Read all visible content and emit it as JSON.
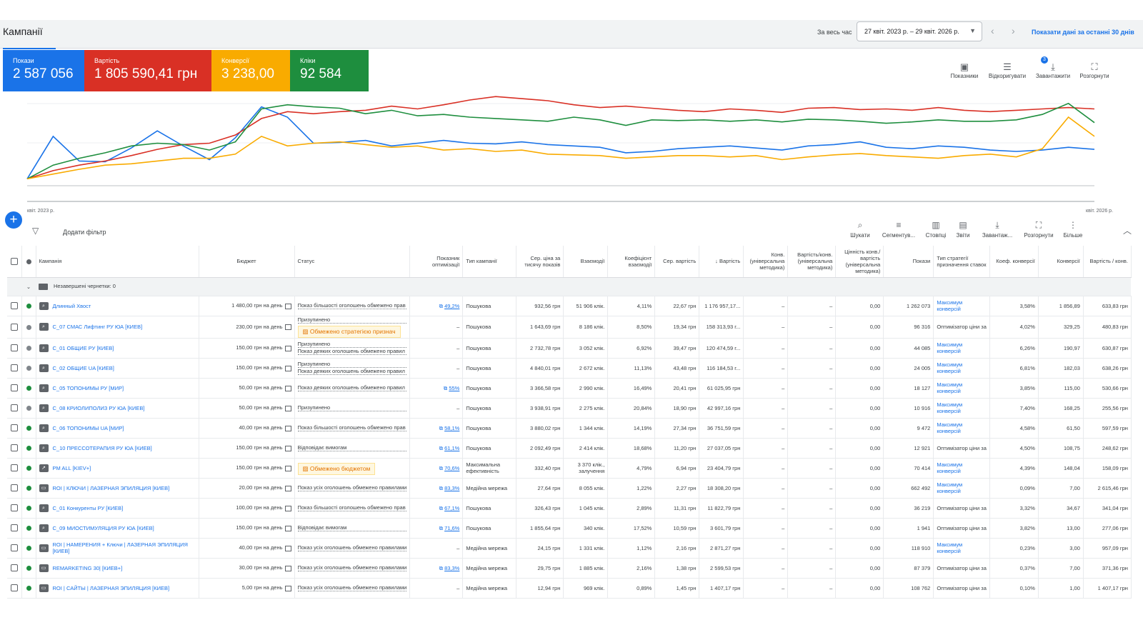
{
  "header": {
    "title": "Кампанії",
    "period_label": "За весь час",
    "date_range": "27 квіт. 2023 р. – 29 квіт. 2026 р.",
    "show_30_label": "Показати дані за останні 30 днів"
  },
  "metrics": [
    {
      "label": "Покази",
      "value": "2 587 056",
      "color": "#1a73e8"
    },
    {
      "label": "Вартість",
      "value": "1 805 590,41 грн",
      "color": "#d93025"
    },
    {
      "label": "Конверсії",
      "value": "3 238,00",
      "color": "#f9ab00"
    },
    {
      "label": "Кліки",
      "value": "92 584",
      "color": "#1e8e3e"
    }
  ],
  "chart_tools": [
    {
      "label": "Показники",
      "icon": "add-chart-icon"
    },
    {
      "label": "Відкоригувати",
      "icon": "tune-icon",
      "badge": "3"
    },
    {
      "label": "Завантажити",
      "icon": "download-icon"
    },
    {
      "label": "Розгорнути",
      "icon": "fullscreen-icon"
    }
  ],
  "chart_data": {
    "type": "line",
    "x_start_label": "квіт. 2023 р.",
    "x_end_label": "квіт. 2026 р.",
    "series": [
      {
        "color": "#1a73e8",
        "values": [
          10,
          72,
          36,
          35,
          55,
          80,
          58,
          38,
          70,
          115,
          100,
          62,
          63,
          66,
          58,
          62,
          66,
          62,
          61,
          64,
          60,
          58,
          56,
          48,
          50,
          54,
          56,
          58,
          55,
          52,
          58,
          60,
          64,
          56,
          54,
          58,
          56,
          52,
          50,
          52,
          56,
          53
        ]
      },
      {
        "color": "#d93025",
        "values": [
          10,
          22,
          30,
          36,
          44,
          53,
          60,
          62,
          74,
          98,
          108,
          105,
          108,
          110,
          116,
          112,
          118,
          125,
          130,
          127,
          124,
          118,
          114,
          116,
          113,
          110,
          108,
          112,
          110,
          107,
          113,
          114,
          111,
          112,
          110,
          114,
          110,
          108,
          110,
          112,
          114,
          112
        ]
      },
      {
        "color": "#1e8e3e",
        "values": [
          10,
          30,
          40,
          48,
          58,
          62,
          60,
          52,
          64,
          112,
          118,
          115,
          113,
          105,
          110,
          102,
          104,
          100,
          98,
          96,
          94,
          100,
          96,
          88,
          96,
          95,
          96,
          94,
          96,
          93,
          97,
          96,
          94,
          91,
          93,
          96,
          94,
          94,
          96,
          104,
          120,
          92
        ]
      },
      {
        "color": "#f9ab00",
        "values": [
          10,
          17,
          24,
          30,
          32,
          36,
          40,
          40,
          46,
          72,
          58,
          62,
          64,
          60,
          56,
          58,
          52,
          54,
          50,
          52,
          46,
          45,
          44,
          40,
          42,
          44,
          44,
          42,
          44,
          38,
          42,
          45,
          47,
          44,
          42,
          40,
          44,
          46,
          42,
          54,
          100,
          72
        ]
      }
    ]
  },
  "filter": {
    "add_label": "Додати фільтр"
  },
  "table_tools": [
    {
      "label": "Шукати",
      "icon": "search-icon"
    },
    {
      "label": "Сегментув...",
      "icon": "segment-icon"
    },
    {
      "label": "Стовпці",
      "icon": "columns-icon"
    },
    {
      "label": "Звіти",
      "icon": "reports-icon"
    },
    {
      "label": "Завантаж...",
      "icon": "download-icon"
    },
    {
      "label": "Розгорнути",
      "icon": "fullscreen-icon"
    },
    {
      "label": "Більше",
      "icon": "more-icon"
    }
  ],
  "columns": [
    "Кампанія",
    "Бюджет",
    "Статус",
    "Показник оптимізації",
    "Тип кампанії",
    "Сер. ціна за тисячу показів",
    "Взаємодії",
    "Коефіцієнт взаємодії",
    "Сер. вартість",
    "↓ Вартість",
    "Конв. (універсальна методика)",
    "Вартість/конв. (універсальна методика)",
    "Цінність конв./вартість (універсальна методика)",
    "Покази",
    "Тип стратегії призначення ставок",
    "Коеф. конверсії",
    "Конверсії",
    "Вартість / конв."
  ],
  "draft_label": "Незавершені чернетки: 0",
  "rows": [
    {
      "status_dot": "#1e8e3e",
      "icon": "search-campaign-icon",
      "name": "Длинный Хвост",
      "budget": "1 480,00 грн на день",
      "status": "Показ більшості оголошень обмежено прав",
      "chip": "",
      "opt": "49,2%",
      "type": "Пошукова",
      "cpm": "932,56 грн",
      "inter": "51 906 клік.",
      "ir": "4,11%",
      "avg": "22,67 грн",
      "cost": "1 176 957,17...",
      "conv_u": "–",
      "cpc_u": "–",
      "val_u": "0,00",
      "impr": "1 262 073",
      "strat": "Максимум конверсій",
      "strat_link": true,
      "cr": "3,58%",
      "conv": "1 856,89",
      "cpa": "633,83 грн"
    },
    {
      "status_dot": "#80868b",
      "icon": "search-campaign-icon",
      "name": "С_07 СМАС Лифтинг РУ ЮА [КИЕВ]",
      "budget": "230,00 грн на день",
      "status": "Призупинено",
      "chip": "Обмежено стратегією признач",
      "opt": "–",
      "type": "Пошукова",
      "cpm": "1 643,69 грн",
      "inter": "8 186 клік.",
      "ir": "8,50%",
      "avg": "19,34 грн",
      "cost": "158 313,93 г...",
      "conv_u": "–",
      "cpc_u": "–",
      "val_u": "0,00",
      "impr": "96 316",
      "strat": "Оптимізатор ціни за",
      "strat_link": false,
      "cr": "4,02%",
      "conv": "329,25",
      "cpa": "480,83 грн"
    },
    {
      "status_dot": "#80868b",
      "icon": "search-campaign-icon",
      "name": "С_01 ОБЩИЕ РУ [КИЕВ]",
      "budget": "150,00 грн на день",
      "status": "Призупинено",
      "status2": "Показ деяких оголошень обмежено правил",
      "chip": "",
      "opt": "–",
      "type": "Пошукова",
      "cpm": "2 732,78 грн",
      "inter": "3 052 клік.",
      "ir": "6,92%",
      "avg": "39,47 грн",
      "cost": "120 474,59 г...",
      "conv_u": "–",
      "cpc_u": "–",
      "val_u": "0,00",
      "impr": "44 085",
      "strat": "Максимум конверсій",
      "strat_link": true,
      "cr": "6,26%",
      "conv": "190,97",
      "cpa": "630,87 грн"
    },
    {
      "status_dot": "#80868b",
      "icon": "search-campaign-icon",
      "name": "С_02 ОБЩИЕ UA [КИЕВ]",
      "budget": "150,00 грн на день",
      "status": "Призупинено",
      "status2": "Показ деяких оголошень обмежено правил",
      "chip": "",
      "opt": "–",
      "type": "Пошукова",
      "cpm": "4 840,01 грн",
      "inter": "2 672 клік.",
      "ir": "11,13%",
      "avg": "43,48 грн",
      "cost": "116 184,53 г...",
      "conv_u": "–",
      "cpc_u": "–",
      "val_u": "0,00",
      "impr": "24 005",
      "strat": "Максимум конверсій",
      "strat_link": true,
      "cr": "6,81%",
      "conv": "182,03",
      "cpa": "638,26 грн"
    },
    {
      "status_dot": "#1e8e3e",
      "icon": "search-campaign-icon",
      "name": "С_05 ТОПОНИМЫ РУ [МИР]",
      "budget": "50,00 грн на день",
      "status": "Показ деяких оголошень обмежено правил",
      "chip": "",
      "opt": "55%",
      "type": "Пошукова",
      "cpm": "3 366,58 грн",
      "inter": "2 990 клік.",
      "ir": "16,49%",
      "avg": "20,41 грн",
      "cost": "61 025,95 грн",
      "conv_u": "–",
      "cpc_u": "–",
      "val_u": "0,00",
      "impr": "18 127",
      "strat": "Максимум конверсій",
      "strat_link": true,
      "cr": "3,85%",
      "conv": "115,00",
      "cpa": "530,66 грн"
    },
    {
      "status_dot": "#80868b",
      "icon": "search-campaign-icon",
      "name": "С_08 КРИОЛИПОЛИЗ РУ ЮА [КИЕВ]",
      "budget": "50,00 грн на день",
      "status": "Призупинено",
      "chip": "",
      "opt": "–",
      "type": "Пошукова",
      "cpm": "3 938,91 грн",
      "inter": "2 275 клік.",
      "ir": "20,84%",
      "avg": "18,90 грн",
      "cost": "42 997,16 грн",
      "conv_u": "–",
      "cpc_u": "–",
      "val_u": "0,00",
      "impr": "10 916",
      "strat": "Максимум конверсій",
      "strat_link": true,
      "cr": "7,40%",
      "conv": "168,25",
      "cpa": "255,56 грн"
    },
    {
      "status_dot": "#1e8e3e",
      "icon": "search-campaign-icon",
      "name": "С_06 ТОПОНИМЫ UA [МИР]",
      "budget": "40,00 грн на день",
      "status": "Показ більшості оголошень обмежено прав",
      "chip": "",
      "opt": "58,1%",
      "type": "Пошукова",
      "cpm": "3 880,02 грн",
      "inter": "1 344 клік.",
      "ir": "14,19%",
      "avg": "27,34 грн",
      "cost": "36 751,59 грн",
      "conv_u": "–",
      "cpc_u": "–",
      "val_u": "0,00",
      "impr": "9 472",
      "strat": "Максимум конверсій",
      "strat_link": true,
      "cr": "4,58%",
      "conv": "61,50",
      "cpa": "597,59 грн"
    },
    {
      "status_dot": "#1e8e3e",
      "icon": "search-campaign-icon",
      "name": "С_10 ПРЕССОТЕРАПИЯ РУ ЮА [КИЕВ]",
      "budget": "150,00 грн на день",
      "status": "Відповідає вимогам",
      "chip": "",
      "opt": "61,1%",
      "type": "Пошукова",
      "cpm": "2 092,49 грн",
      "inter": "2 414 клік.",
      "ir": "18,68%",
      "avg": "11,20 грн",
      "cost": "27 037,05 грн",
      "conv_u": "–",
      "cpc_u": "–",
      "val_u": "0,00",
      "impr": "12 921",
      "strat": "Оптимізатор ціни за",
      "strat_link": false,
      "cr": "4,50%",
      "conv": "108,75",
      "cpa": "248,62 грн"
    },
    {
      "status_dot": "#1e8e3e",
      "icon": "pmax-campaign-icon",
      "name": "PM ALL [KIEV+]",
      "budget": "150,00 грн на день",
      "status": "",
      "chip": "Обмежено бюджетом",
      "opt": "70,6%",
      "type": "Максимальна ефективність",
      "cpm": "332,40 грн",
      "inter": "3 370 клік., залучення",
      "ir": "4,79%",
      "avg": "6,94 грн",
      "cost": "23 404,79 грн",
      "conv_u": "–",
      "cpc_u": "–",
      "val_u": "0,00",
      "impr": "70 414",
      "strat": "Максимум конверсій",
      "strat_link": true,
      "cr": "4,39%",
      "conv": "148,04",
      "cpa": "158,09 грн"
    },
    {
      "status_dot": "#1e8e3e",
      "icon": "display-campaign-icon",
      "name": "ROI | КЛЮЧИ | ЛАЗЕРНАЯ ЭПИЛЯЦИЯ [КИЕВ]",
      "budget": "20,00 грн на день",
      "status": "Показ усіх оголошень обмежено правилами",
      "chip": "",
      "opt": "83,3%",
      "type": "Медійна мережа",
      "cpm": "27,64 грн",
      "inter": "8 055 клік.",
      "ir": "1,22%",
      "avg": "2,27 грн",
      "cost": "18 308,20 грн",
      "conv_u": "–",
      "cpc_u": "–",
      "val_u": "0,00",
      "impr": "662 492",
      "strat": "Максимум конверсій",
      "strat_link": true,
      "cr": "0,09%",
      "conv": "7,00",
      "cpa": "2 615,46 грн"
    },
    {
      "status_dot": "#1e8e3e",
      "icon": "search-campaign-icon",
      "name": "С_01 Конкуренты РУ [КИЕВ]",
      "budget": "100,00 грн на день",
      "status": "Показ більшості оголошень обмежено прав",
      "chip": "",
      "opt": "67,1%",
      "type": "Пошукова",
      "cpm": "326,43 грн",
      "inter": "1 045 клік.",
      "ir": "2,89%",
      "avg": "11,31 грн",
      "cost": "11 822,79 грн",
      "conv_u": "–",
      "cpc_u": "–",
      "val_u": "0,00",
      "impr": "36 219",
      "strat": "Оптимізатор ціни за",
      "strat_link": false,
      "cr": "3,32%",
      "conv": "34,67",
      "cpa": "341,04 грн"
    },
    {
      "status_dot": "#1e8e3e",
      "icon": "search-campaign-icon",
      "name": "С_09 МИОСТИМУЛЯЦИЯ РУ ЮА [КИЕВ]",
      "budget": "150,00 грн на день",
      "status": "Відповідає вимогам",
      "chip": "",
      "opt": "71,6%",
      "type": "Пошукова",
      "cpm": "1 855,64 грн",
      "inter": "340 клік.",
      "ir": "17,52%",
      "avg": "10,59 грн",
      "cost": "3 601,79 грн",
      "conv_u": "–",
      "cpc_u": "–",
      "val_u": "0,00",
      "impr": "1 941",
      "strat": "Оптимізатор ціни за",
      "strat_link": false,
      "cr": "3,82%",
      "conv": "13,00",
      "cpa": "277,06 грн"
    },
    {
      "status_dot": "#1e8e3e",
      "icon": "display-campaign-icon",
      "name": "ROI | НАМЕРЕНИЯ + Ключи | ЛАЗЕРНАЯ ЭПИЛЯЦИЯ [КИЕВ]",
      "budget": "40,00 грн на день",
      "status": "Показ усіх оголошень обмежено правилами",
      "chip": "",
      "opt": "–",
      "type": "Медійна мережа",
      "cpm": "24,15 грн",
      "inter": "1 331 клік.",
      "ir": "1,12%",
      "avg": "2,16 грн",
      "cost": "2 871,27 грн",
      "conv_u": "–",
      "cpc_u": "–",
      "val_u": "0,00",
      "impr": "118 910",
      "strat": "Максимум конверсій",
      "strat_link": true,
      "cr": "0,23%",
      "conv": "3,00",
      "cpa": "957,09 грн"
    },
    {
      "status_dot": "#1e8e3e",
      "icon": "display-campaign-icon",
      "name": "REMARKETING 30| [КИЕВ+]",
      "budget": "30,00 грн на день",
      "status": "Показ усіх оголошень обмежено правилами",
      "chip": "",
      "opt": "83,3%",
      "type": "Медійна мережа",
      "cpm": "29,75 грн",
      "inter": "1 885 клік.",
      "ir": "2,16%",
      "avg": "1,38 грн",
      "cost": "2 599,53 грн",
      "conv_u": "–",
      "cpc_u": "–",
      "val_u": "0,00",
      "impr": "87 379",
      "strat": "Оптимізатор ціни за",
      "strat_link": false,
      "cr": "0,37%",
      "conv": "7,00",
      "cpa": "371,36 грн"
    },
    {
      "status_dot": "#1e8e3e",
      "icon": "display-campaign-icon",
      "name": "ROI | САЙТЫ | ЛАЗЕРНАЯ ЭПИЛЯЦИЯ [КИЕВ]",
      "budget": "5,00 грн на день",
      "status": "Показ усіх оголошень обмежено правилами",
      "chip": "",
      "opt": "–",
      "type": "Медійна мережа",
      "cpm": "12,94 грн",
      "inter": "969 клік.",
      "ir": "0,89%",
      "avg": "1,45 грн",
      "cost": "1 407,17 грн",
      "conv_u": "–",
      "cpc_u": "–",
      "val_u": "0,00",
      "impr": "108 762",
      "strat": "Оптимізатор ціни за",
      "strat_link": false,
      "cr": "0,10%",
      "conv": "1,00",
      "cpa": "1 407,17 грн"
    }
  ]
}
